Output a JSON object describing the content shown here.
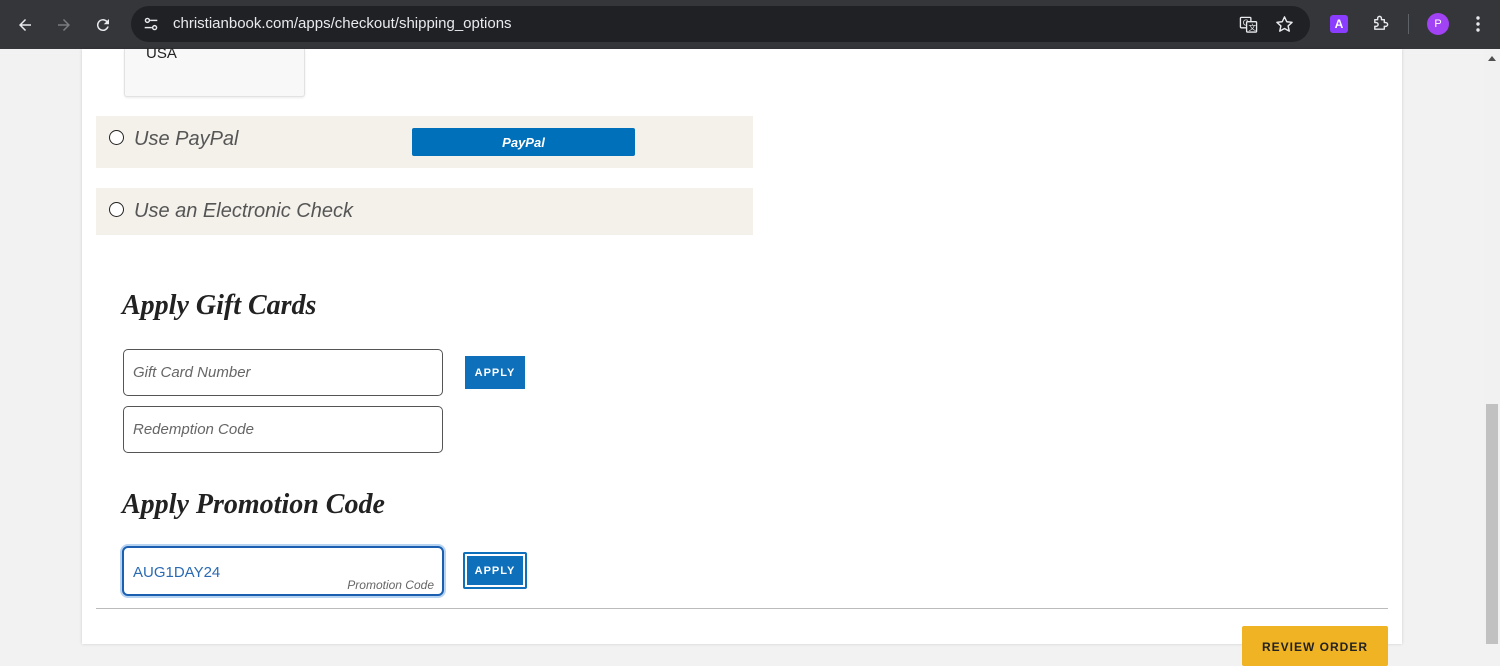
{
  "browser": {
    "url": "christianbook.com/apps/checkout/shipping_options",
    "extension_letter": "A",
    "profile_initial": "P"
  },
  "address": {
    "country": "USA"
  },
  "payment_options": {
    "paypal_label": "Use PayPal",
    "paypal_button": "PayPal",
    "echeck_label": "Use an Electronic Check"
  },
  "gift_cards": {
    "title": "Apply Gift Cards",
    "card_number_placeholder": "Gift Card Number",
    "redemption_placeholder": "Redemption Code",
    "apply_label": "APPLY"
  },
  "promotion": {
    "title": "Apply Promotion Code",
    "code_value": "AUG1DAY24",
    "field_label": "Promotion Code",
    "apply_label": "APPLY"
  },
  "footer": {
    "review_label": "REVIEW ORDER"
  },
  "colors": {
    "chrome_bg": "#35363a",
    "apply_blue": "#0e6fba",
    "paypal_blue": "#0070ba",
    "option_bg": "#f4f1eb",
    "review_yellow": "#f0b323"
  }
}
